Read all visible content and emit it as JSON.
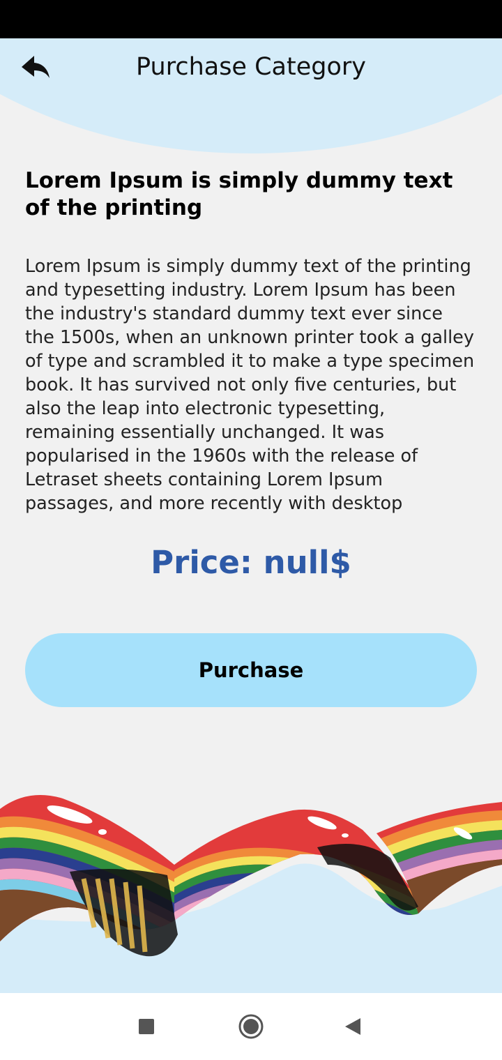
{
  "header": {
    "title": "Purchase Category",
    "back_icon": "back-arrow-icon"
  },
  "content": {
    "headline": "Lorem Ipsum is simply dummy text of the printing",
    "body": "Lorem Ipsum is simply dummy text of the printing and typesetting industry. Lorem Ipsum has been the industry's standard dummy text ever since the 1500s, when an unknown printer took a galley of type and scrambled it to make a type specimen book. It has survived not only five centuries, but also the leap into electronic typesetting, remaining essentially unchanged. It was popularised in the 1960s with the release of Letraset sheets containing Lorem Ipsum passages, and more recently with desktop",
    "price": "Price: null$"
  },
  "actions": {
    "purchase_label": "Purchase"
  },
  "nav": {
    "recents_icon": "square-icon",
    "home_icon": "circle-home-icon",
    "back_icon": "triangle-back-icon"
  },
  "colors": {
    "header_bg": "#d5ecf9",
    "page_bg": "#f1f1f1",
    "price_text": "#2e5aa7",
    "button_bg": "#a6e1fb"
  }
}
